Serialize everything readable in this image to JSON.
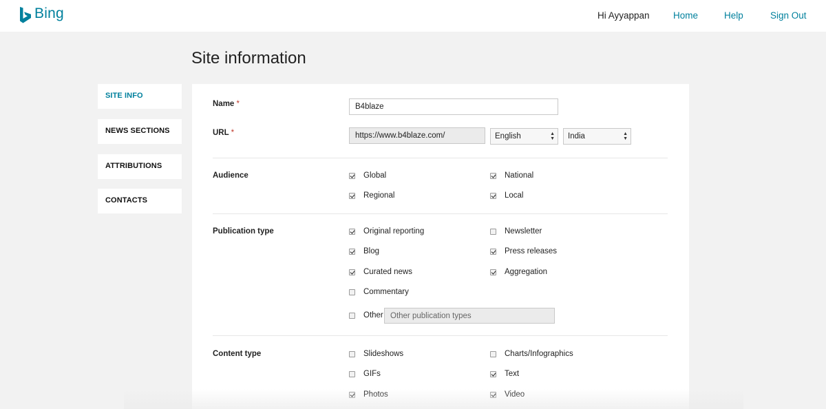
{
  "header": {
    "brand": "Bing",
    "brand_color": "#00809d",
    "greeting": "Hi Ayyappan",
    "links": {
      "home": "Home",
      "help": "Help",
      "sign_out": "Sign Out"
    }
  },
  "page_title": "Site information",
  "sidebar": {
    "items": [
      {
        "label": "SITE INFO",
        "active": true
      },
      {
        "label": "NEWS SECTIONS",
        "active": false
      },
      {
        "label": "ATTRIBUTIONS",
        "active": false
      },
      {
        "label": "CONTACTS",
        "active": false
      }
    ]
  },
  "form": {
    "required_mark": "*",
    "name": {
      "label": "Name",
      "value": "B4blaze"
    },
    "url": {
      "label": "URL",
      "value": "https://www.b4blaze.com/",
      "language": "English",
      "country": "India"
    },
    "audience": {
      "label": "Audience",
      "options": [
        {
          "label": "Global",
          "checked": true
        },
        {
          "label": "National",
          "checked": true
        },
        {
          "label": "Regional",
          "checked": true
        },
        {
          "label": "Local",
          "checked": true
        }
      ]
    },
    "publication_type": {
      "label": "Publication type",
      "options": [
        {
          "label": "Original reporting",
          "checked": true
        },
        {
          "label": "Newsletter",
          "checked": false
        },
        {
          "label": "Blog",
          "checked": true
        },
        {
          "label": "Press releases",
          "checked": true
        },
        {
          "label": "Curated news",
          "checked": true
        },
        {
          "label": "Aggregation",
          "checked": true
        },
        {
          "label": "Commentary",
          "checked": false
        }
      ],
      "other": {
        "label": "Other",
        "checked": false,
        "placeholder": "Other publication types"
      }
    },
    "content_type": {
      "label": "Content type",
      "options": [
        {
          "label": "Slideshows",
          "checked": false
        },
        {
          "label": "Charts/Infographics",
          "checked": false
        },
        {
          "label": "GIFs",
          "checked": false
        },
        {
          "label": "Text",
          "checked": true
        },
        {
          "label": "Photos",
          "checked": true
        },
        {
          "label": "Video",
          "checked": true
        }
      ]
    }
  }
}
